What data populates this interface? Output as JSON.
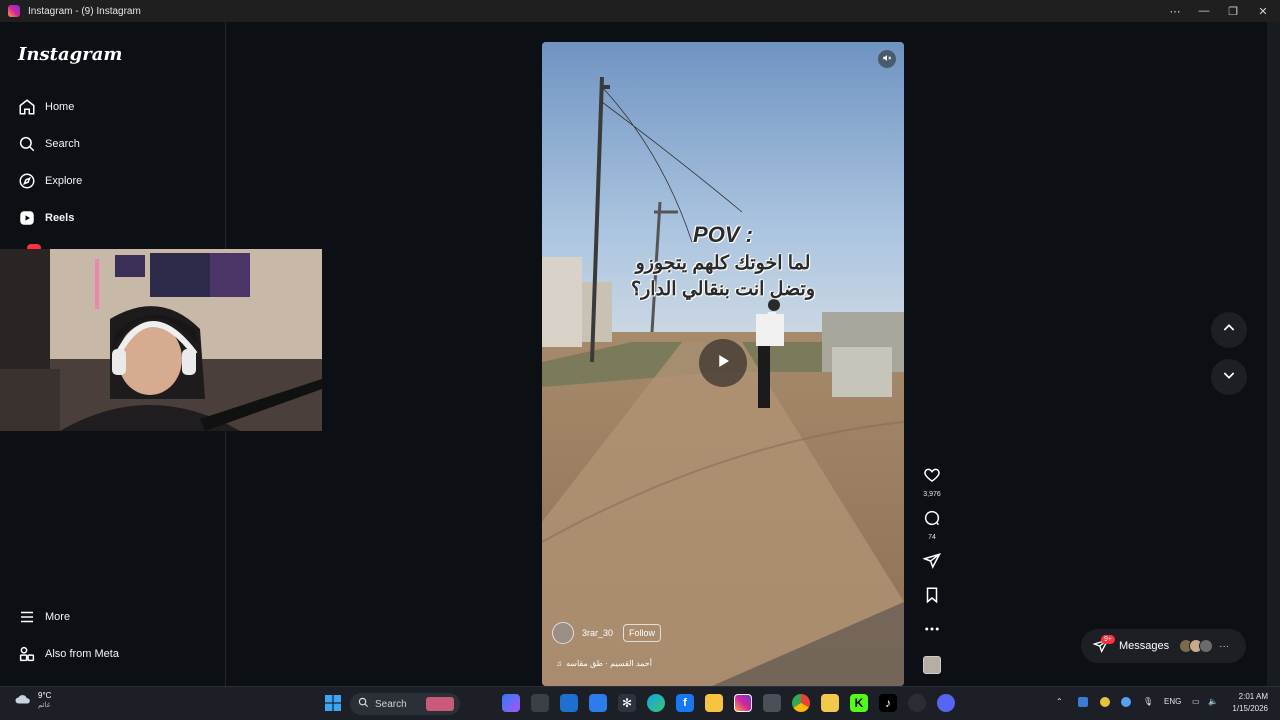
{
  "window": {
    "title": "Instagram - (9) Instagram"
  },
  "sidebar": {
    "logo": "Instagram",
    "items": [
      {
        "label": "Home",
        "icon": "home-icon"
      },
      {
        "label": "Search",
        "icon": "search-icon"
      },
      {
        "label": "Explore",
        "icon": "compass-icon"
      },
      {
        "label": "Reels",
        "icon": "reels-icon"
      }
    ],
    "more_label": "More",
    "meta_label": "Also from Meta"
  },
  "reel": {
    "overlay_title": "POV :",
    "overlay_line1": "لما اخوتك كلهم يتجوزو",
    "overlay_line2": "وتضل انت بنقالي الدار؟",
    "username": "3rar_30",
    "follow_label": "Follow",
    "audio": "أحمد القسيم · طق مقاسه"
  },
  "actions": {
    "likes": "3,976",
    "comments": "74"
  },
  "messages": {
    "label": "Messages",
    "badge": "9+"
  },
  "taskbar": {
    "temperature": "9°C",
    "condition": "غائم",
    "search_label": "Search",
    "language": "ENG",
    "time": "2:01 AM",
    "date": "1/15/2026"
  },
  "colors": {
    "background": "#0c0f14",
    "notification": "#ff3040",
    "taskbar": "#1c1f26"
  }
}
